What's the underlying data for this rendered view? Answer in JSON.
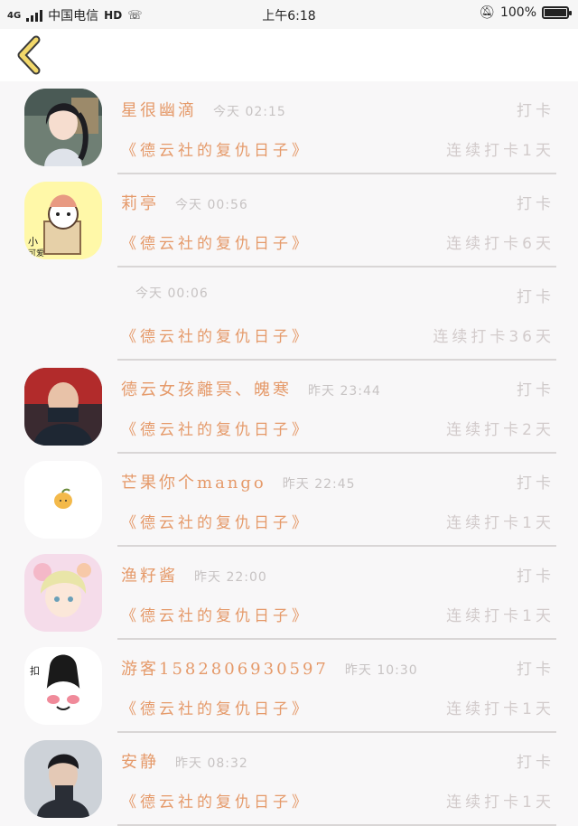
{
  "status": {
    "network": "4G",
    "carrier": "中国电信",
    "hd": "HD",
    "time": "上午6:18",
    "battery": "100%",
    "battery_level": 1.0
  },
  "nav": {
    "back_icon": "chevron-left-icon"
  },
  "entries": [
    {
      "name": "星很幽滴",
      "time": "今天 02:15",
      "punch": "打卡",
      "title": "《德云社的复仇日子》",
      "streak": "连续打卡1天"
    },
    {
      "name": "莉亭",
      "time": "今天 00:56",
      "punch": "打卡",
      "title": "《德云社的复仇日子》",
      "streak": "连续打卡6天"
    },
    {
      "name": "",
      "time": "今天 00:06",
      "punch": "打卡",
      "title": "《德云社的复仇日子》",
      "streak": "连续打卡36天"
    },
    {
      "name": "德云女孩離冥、魄寒",
      "time": "昨天 23:44",
      "punch": "打卡",
      "title": "《德云社的复仇日子》",
      "streak": "连续打卡2天"
    },
    {
      "name": "芒果你个mango",
      "time": "昨天 22:45",
      "punch": "打卡",
      "title": "《德云社的复仇日子》",
      "streak": "连续打卡1天"
    },
    {
      "name": "渔籽酱",
      "time": "昨天 22:00",
      "punch": "打卡",
      "title": "《德云社的复仇日子》",
      "streak": "连续打卡1天"
    },
    {
      "name": "游客1582806930597",
      "time": "昨天 10:30",
      "punch": "打卡",
      "title": "《德云社的复仇日子》",
      "streak": "连续打卡1天"
    },
    {
      "name": "安静",
      "time": "昨天 08:32",
      "punch": "打卡",
      "title": "《德云社的复仇日子》",
      "streak": "连续打卡1天"
    }
  ],
  "colors": {
    "accent": "#e59a6a",
    "muted": "#cfcaca"
  }
}
